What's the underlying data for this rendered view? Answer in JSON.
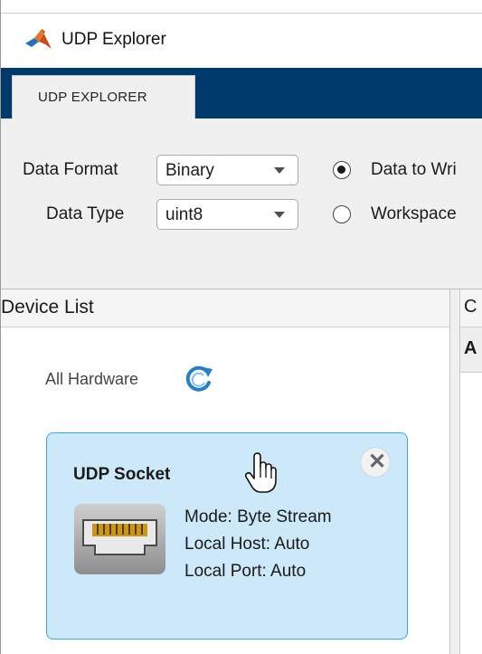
{
  "window": {
    "title": "UDP Explorer"
  },
  "toolstrip": {
    "tab_label": "UDP EXPLORER",
    "data_format": {
      "label": "Data Format",
      "value": "Binary"
    },
    "data_type": {
      "label": "Data Type",
      "value": "uint8"
    },
    "radio_options": [
      {
        "label": "Data to Wri",
        "selected": true
      },
      {
        "label": "Workspace",
        "selected": false
      }
    ]
  },
  "device_list": {
    "header": "Device List",
    "all_hardware_label": "All Hardware",
    "refresh_icon": "refresh-icon",
    "card": {
      "title": "UDP Socket",
      "icon": "ethernet-port-icon",
      "details": [
        "Mode: Byte Stream",
        "Local Host: Auto",
        "Local Port: Auto"
      ]
    }
  },
  "right_panel": {
    "header1": "C",
    "header2": "A"
  },
  "colors": {
    "toolstrip_header": "#003a6c",
    "card_bg": "#cde8f8",
    "card_border": "#3da5e0"
  }
}
